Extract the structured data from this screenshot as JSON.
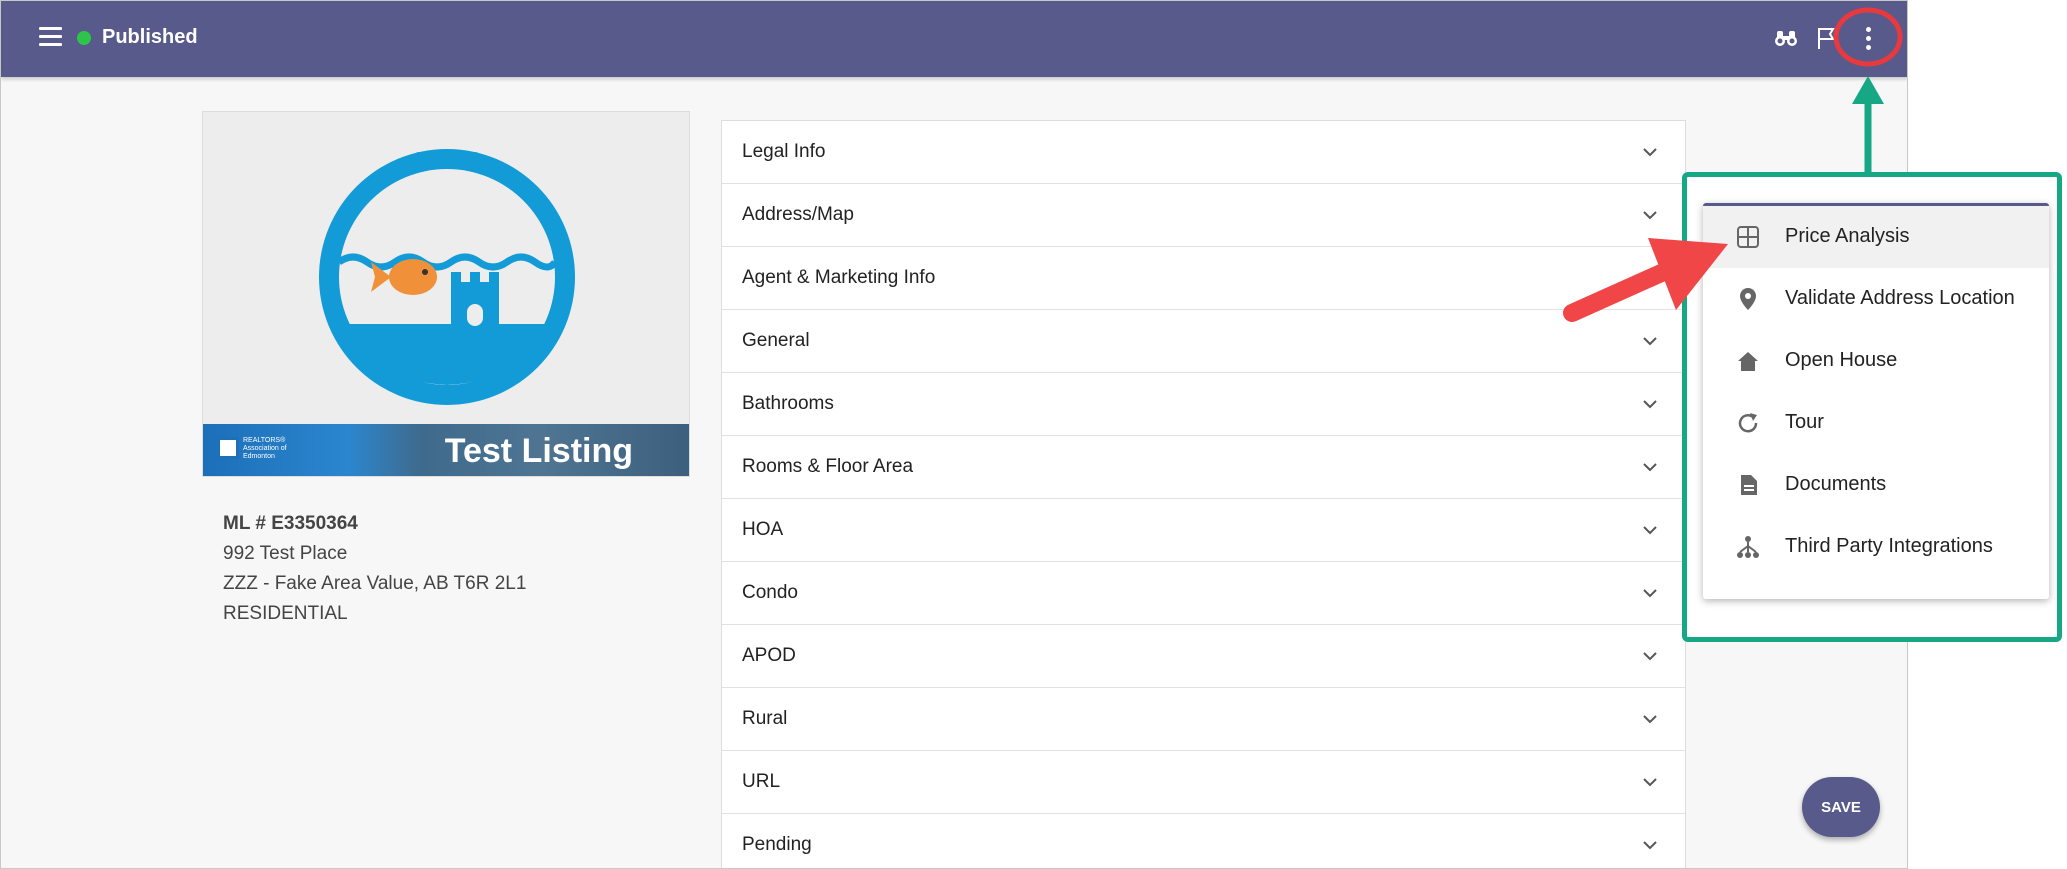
{
  "topbar": {
    "status": "Published",
    "status_color": "#2ec44a",
    "bar_color": "#575a8a",
    "icons": [
      "menu-icon",
      "binoculars-icon",
      "flag-icon",
      "more-vert-icon"
    ]
  },
  "listing": {
    "image_banner_title": "Test Listing",
    "banner_logo_text": "REALTORS® Association of Edmonton",
    "ml_number": "ML # E3350364",
    "address_line1": "992 Test Place",
    "address_line2": "ZZZ - Fake Area Value, AB T6R 2L1",
    "property_type": "RESIDENTIAL"
  },
  "sections": [
    {
      "label": "Legal Info"
    },
    {
      "label": "Address/Map"
    },
    {
      "label": "Agent & Marketing Info"
    },
    {
      "label": "General"
    },
    {
      "label": "Bathrooms"
    },
    {
      "label": "Rooms & Floor Area"
    },
    {
      "label": "HOA"
    },
    {
      "label": "Condo"
    },
    {
      "label": "APOD"
    },
    {
      "label": "Rural"
    },
    {
      "label": "URL"
    },
    {
      "label": "Pending"
    }
  ],
  "menu": {
    "items": [
      {
        "label": "Price Analysis",
        "icon": "grid-icon"
      },
      {
        "label": "Validate Address Location",
        "icon": "location-pin-icon"
      },
      {
        "label": "Open House",
        "icon": "home-icon"
      },
      {
        "label": "Tour",
        "icon": "refresh-icon"
      },
      {
        "label": "Documents",
        "icon": "document-icon"
      },
      {
        "label": "Third Party Integrations",
        "icon": "integrations-icon"
      }
    ],
    "highlight_color": "#16a784"
  },
  "save_button": {
    "label": "SAVE"
  },
  "annotations": {
    "circle_color": "#e8393f",
    "arrow_color": "#f04648",
    "green_arrow_color": "#16a784"
  }
}
